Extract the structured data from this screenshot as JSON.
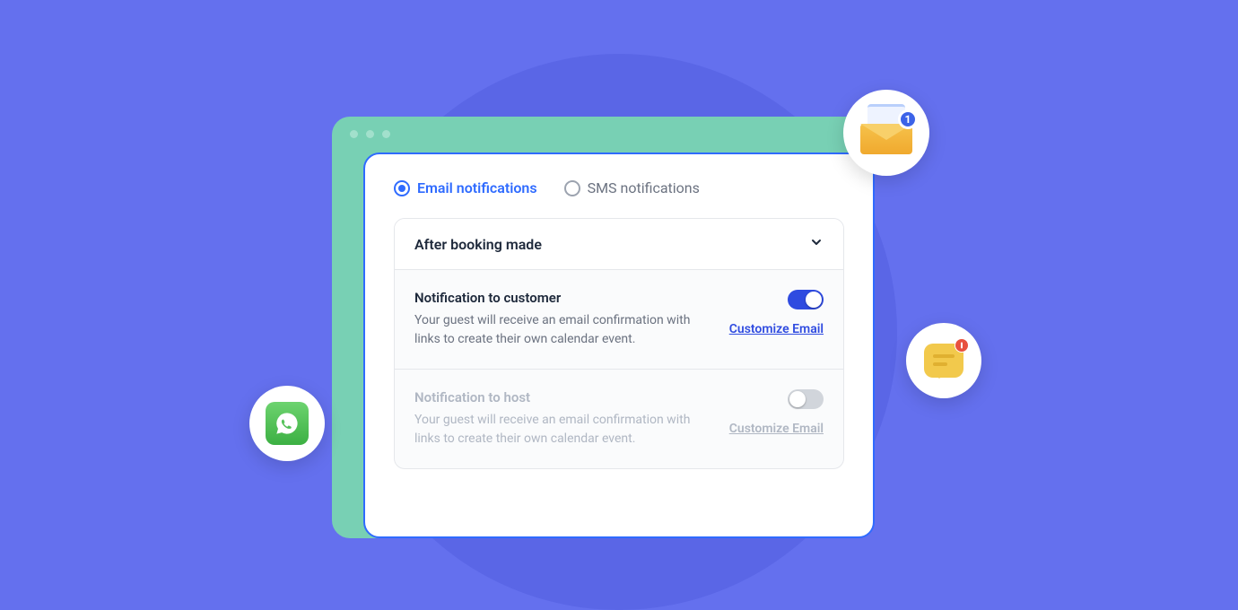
{
  "tabs": {
    "email": "Email notifications",
    "sms": "SMS notifications"
  },
  "panel": {
    "header": "After booking made"
  },
  "customer": {
    "title": "Notification to customer",
    "desc": "Your guest will receive an email confirmation with links to create their own calendar event.",
    "customize": "Customize Email"
  },
  "host": {
    "title": "Notification to host",
    "desc": "Your guest will receive an email confirmation with links to create their own calendar event.",
    "customize": "Customize Email"
  },
  "mail_badge": "1"
}
